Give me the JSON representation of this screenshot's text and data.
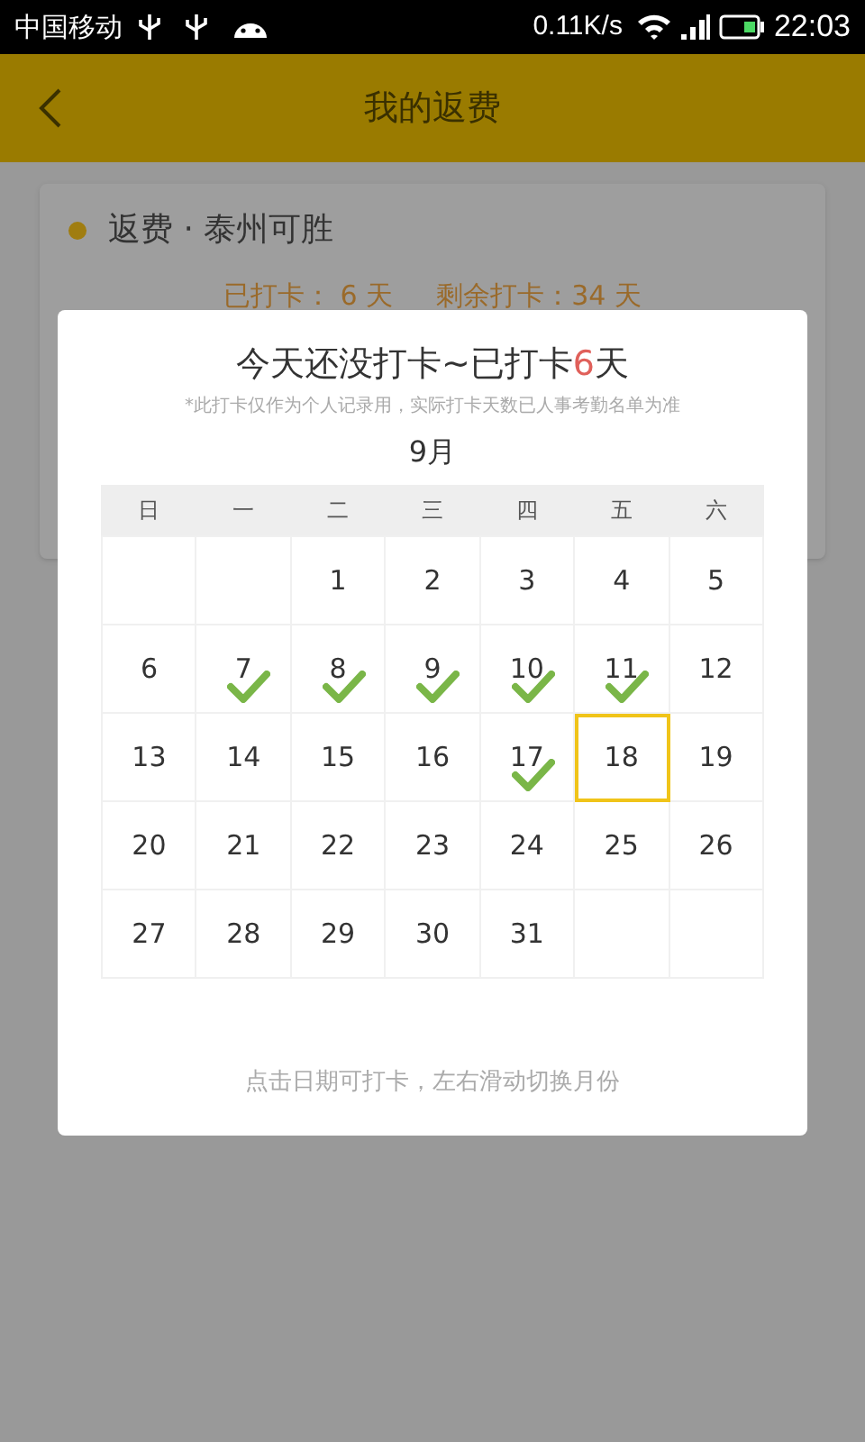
{
  "status_bar": {
    "carrier": "中国移动",
    "speed": "0.11K/s",
    "time": "22:03"
  },
  "header": {
    "title": "我的返费"
  },
  "card": {
    "title": "返费 · 泰州可胜",
    "checked_in": "已打卡： 6 天",
    "remaining": "剩余打卡：34 天"
  },
  "dialog": {
    "title_start": "今天还没打卡~已打卡",
    "title_count": "6",
    "title_end": "天",
    "note": "*此打卡仅作为个人记录用，实际打卡天数已人事考勤名单为准",
    "month": "9月",
    "weekdays": [
      "日",
      "一",
      "二",
      "三",
      "四",
      "五",
      "六"
    ],
    "cells": [
      {
        "kind": "blank"
      },
      {
        "kind": "blank"
      },
      {
        "kind": "day",
        "day": "1",
        "checked": false,
        "selected": false
      },
      {
        "kind": "day",
        "day": "2",
        "checked": false,
        "selected": false
      },
      {
        "kind": "day",
        "day": "3",
        "checked": false,
        "selected": false
      },
      {
        "kind": "day",
        "day": "4",
        "checked": false,
        "selected": false
      },
      {
        "kind": "day",
        "day": "5",
        "checked": false,
        "selected": false
      },
      {
        "kind": "day",
        "day": "6",
        "checked": false,
        "selected": false
      },
      {
        "kind": "day",
        "day": "7",
        "checked": true,
        "selected": false
      },
      {
        "kind": "day",
        "day": "8",
        "checked": true,
        "selected": false
      },
      {
        "kind": "day",
        "day": "9",
        "checked": true,
        "selected": false
      },
      {
        "kind": "day",
        "day": "10",
        "checked": true,
        "selected": false
      },
      {
        "kind": "day",
        "day": "11",
        "checked": true,
        "selected": false
      },
      {
        "kind": "day",
        "day": "12",
        "checked": false,
        "selected": false
      },
      {
        "kind": "day",
        "day": "13",
        "checked": false,
        "selected": false
      },
      {
        "kind": "day",
        "day": "14",
        "checked": false,
        "selected": false
      },
      {
        "kind": "day",
        "day": "15",
        "checked": false,
        "selected": false
      },
      {
        "kind": "day",
        "day": "16",
        "checked": false,
        "selected": false
      },
      {
        "kind": "day",
        "day": "17",
        "checked": true,
        "selected": false
      },
      {
        "kind": "day",
        "day": "18",
        "checked": false,
        "selected": true
      },
      {
        "kind": "day",
        "day": "19",
        "checked": false,
        "selected": false
      },
      {
        "kind": "day",
        "day": "20",
        "checked": false,
        "selected": false
      },
      {
        "kind": "day",
        "day": "21",
        "checked": false,
        "selected": false
      },
      {
        "kind": "day",
        "day": "22",
        "checked": false,
        "selected": false
      },
      {
        "kind": "day",
        "day": "23",
        "checked": false,
        "selected": false
      },
      {
        "kind": "day",
        "day": "24",
        "checked": false,
        "selected": false
      },
      {
        "kind": "day",
        "day": "25",
        "checked": false,
        "selected": false
      },
      {
        "kind": "day",
        "day": "26",
        "checked": false,
        "selected": false
      },
      {
        "kind": "day",
        "day": "27",
        "checked": false,
        "selected": false
      },
      {
        "kind": "day",
        "day": "28",
        "checked": false,
        "selected": false
      },
      {
        "kind": "day",
        "day": "29",
        "checked": false,
        "selected": false
      },
      {
        "kind": "day",
        "day": "30",
        "checked": false,
        "selected": false
      },
      {
        "kind": "day",
        "day": "31",
        "checked": false,
        "selected": false
      },
      {
        "kind": "blank"
      },
      {
        "kind": "blank"
      }
    ],
    "hint": "点击日期可打卡，左右滑动切换月份"
  }
}
